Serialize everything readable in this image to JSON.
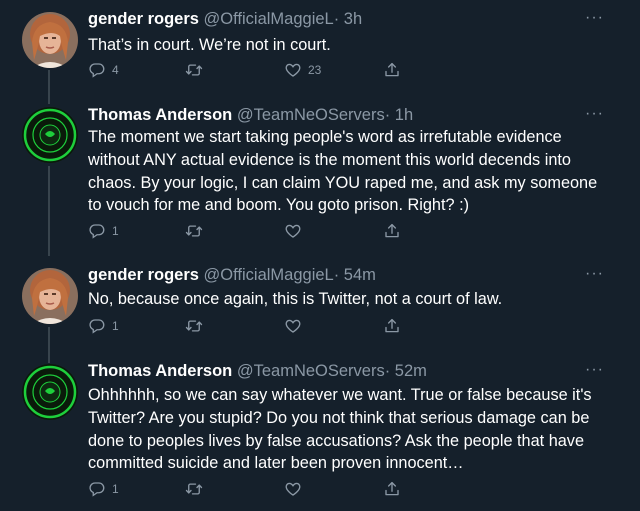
{
  "colors": {
    "background": "#15202b",
    "secondary_text": "#8b98a5",
    "thread_line": "#38444d",
    "text": "#ffffff"
  },
  "tweets": [
    {
      "author": "gender rogers",
      "handle": "@OfficialMaggieL",
      "time": "· 3h",
      "text": "That’s in court. We’re not in court.",
      "avatar": "photo-avatar",
      "reply_count": "4",
      "retweet_count": "",
      "like_count": "23",
      "more_label": "···"
    },
    {
      "author": "Thomas Anderson",
      "handle": "@TeamNeOServers",
      "time": "· 1h",
      "text_lines": [
        "The moment we start taking people's word as irrefutable evidence",
        "without ANY actual evidence is the moment this world decends into",
        "chaos. By your logic, I can claim YOU raped me, and ask my someone",
        "to vouch for me and boom. You goto prison. Right? :)"
      ],
      "avatar": "team-neo-logo-avatar",
      "avatar_logo_text": "TEAM NEO",
      "reply_count": "1",
      "retweet_count": "",
      "like_count": "",
      "more_label": "···"
    },
    {
      "author": "gender rogers",
      "handle": "@OfficialMaggieL",
      "time": "· 54m",
      "text": "No, because once again, this is Twitter, not a court of law.",
      "avatar": "photo-avatar",
      "reply_count": "1",
      "retweet_count": "",
      "like_count": "",
      "more_label": "···"
    },
    {
      "author": "Thomas Anderson",
      "handle": "@TeamNeOServers",
      "time": "· 52m",
      "text_lines": [
        "Ohhhhhh, so we can say whatever we want. True or false because it's",
        "Twitter? Are you stupid? Do you not think that serious damage can be",
        "done to peoples lives by false accusations? Ask the people that have",
        "committed suicide and later been proven innocent…"
      ],
      "avatar": "team-neo-logo-avatar",
      "avatar_logo_text": "TEAM NEO",
      "reply_count": "1",
      "retweet_count": "",
      "like_count": "",
      "more_label": "···"
    }
  ]
}
